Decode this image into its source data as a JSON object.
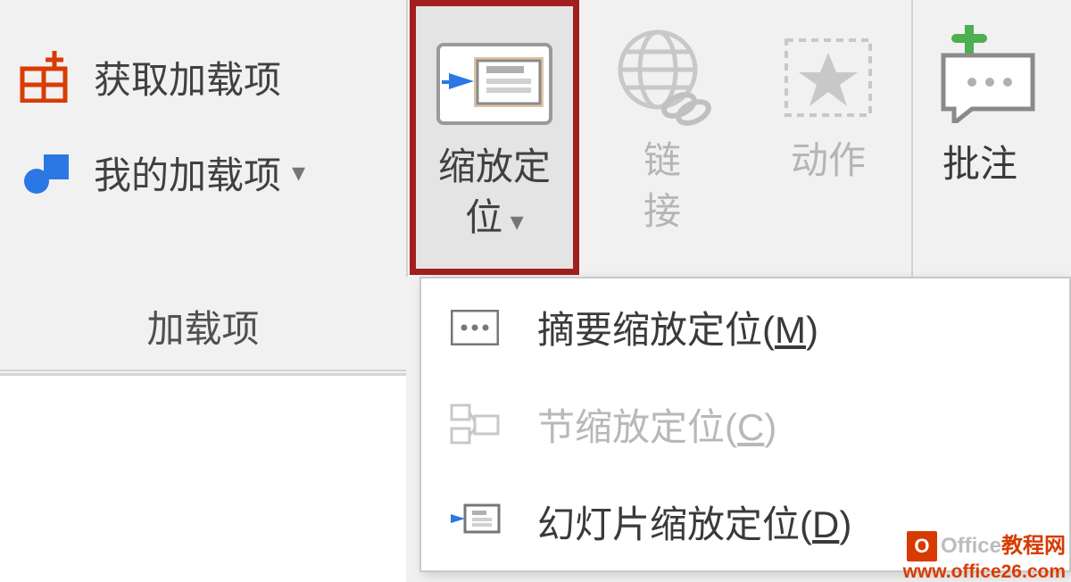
{
  "addins": {
    "get_label": "获取加载项",
    "my_label": "我的加载项",
    "group_label": "加载项"
  },
  "ribbon": {
    "zoom_label_line1": "缩放定",
    "zoom_label_line2": "位",
    "link_label_line1": "链",
    "link_label_line2": "接",
    "action_label_line1": "动作",
    "annotate_label": "批注"
  },
  "dropdown": {
    "items": [
      {
        "label_prefix": "摘要缩放定位(",
        "hot": "M",
        "label_suffix": ")",
        "enabled": true
      },
      {
        "label_prefix": "节缩放定位(",
        "hot": "C",
        "label_suffix": ")",
        "enabled": false
      },
      {
        "label_prefix": "幻灯片缩放定位(",
        "hot": "D",
        "label_suffix": ")",
        "enabled": true
      }
    ]
  },
  "watermark": {
    "brand1": "Office",
    "brand2": "教程网",
    "url": "www.office26.com"
  }
}
